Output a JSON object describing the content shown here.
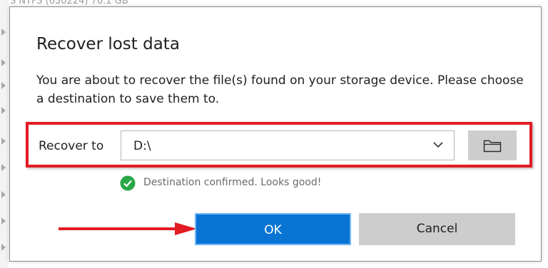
{
  "background": {
    "partial_text": "S     NTFS (630224)   70.1 GB"
  },
  "dialog": {
    "title": "Recover lost data",
    "message": "You are about to recover the file(s) found on your storage device. Please choose a destination to save them to.",
    "recover_to_label": "Recover to",
    "destination_value": "D:\\",
    "browse_icon": "folder-icon",
    "dropdown_icon": "chevron-down-icon",
    "status_icon": "check-circle-icon",
    "status_text": "Destination confirmed. Looks good!",
    "ok_label": "OK",
    "cancel_label": "Cancel"
  },
  "colors": {
    "primary_button": "#0a74d4",
    "secondary_button": "#cdcdcd",
    "highlight": "#e31b23",
    "success": "#2aa748"
  }
}
